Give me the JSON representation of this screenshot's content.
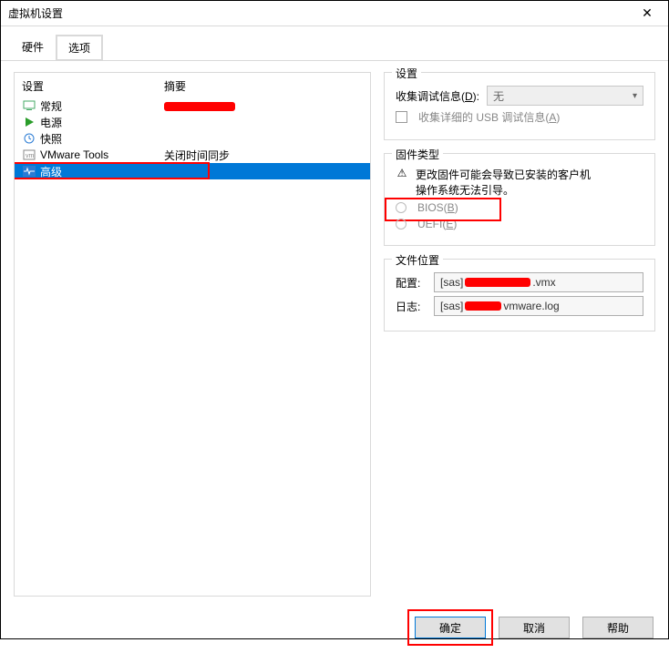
{
  "window": {
    "title": "虚拟机设置"
  },
  "tabs": {
    "hardware": "硬件",
    "options": "选项"
  },
  "left": {
    "col_setting": "设置",
    "col_summary": "摘要",
    "items": [
      {
        "name": "常规",
        "summary_redacted": true
      },
      {
        "name": "电源",
        "summary": ""
      },
      {
        "name": "快照",
        "summary": ""
      },
      {
        "name": "VMware Tools",
        "summary": "关闭时间同步"
      },
      {
        "name": "高级",
        "summary": ""
      }
    ]
  },
  "settings_group": {
    "title": "设置",
    "debug_label_prefix": "收集调试信息(",
    "debug_label_key": "D",
    "debug_label_suffix": "):",
    "debug_value": "无",
    "usb_label_prefix": "收集详细的 USB 调试信息(",
    "usb_label_key": "A",
    "usb_label_suffix": ")"
  },
  "firmware_group": {
    "title": "固件类型",
    "warning_line1": "更改固件可能会导致已安装的客户机",
    "warning_line2": "操作系统无法引导。",
    "bios_prefix": "BIOS(",
    "bios_key": "B",
    "bios_suffix": ")",
    "uefi_prefix": "UEFI(",
    "uefi_key": "E",
    "uefi_suffix": ")"
  },
  "location_group": {
    "title": "文件位置",
    "config_label": "配置:",
    "config_value_prefix": "[sas] ",
    "config_value_suffix": ".vmx",
    "log_label": "日志:",
    "log_value_prefix": "[sas] ",
    "log_value_suffix": "vmware.log"
  },
  "buttons": {
    "ok": "确定",
    "cancel": "取消",
    "help": "帮助"
  }
}
